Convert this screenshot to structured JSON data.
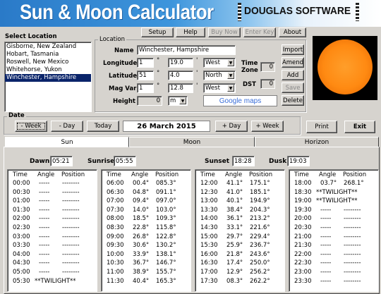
{
  "banner": {
    "title": "Sun & Moon Calculator",
    "company": "DOUGLAS SOFTWARE"
  },
  "menu": [
    {
      "label": "Setup",
      "enabled": true
    },
    {
      "label": "Help",
      "enabled": true
    },
    {
      "label": "Buy Now",
      "enabled": false
    },
    {
      "label": "Enter Key",
      "enabled": false
    },
    {
      "label": "About",
      "enabled": true
    }
  ],
  "select_location": {
    "title": "Select Location",
    "items": [
      "Gisborne, New Zealand",
      "Hobart, Tasmania",
      "Roswell, New Mexico",
      "Whitehorse, Yukon",
      "Winchester, Hampshire"
    ],
    "selected_index": 4
  },
  "location": {
    "title": "Location",
    "name_label": "Name",
    "name": "Winchester, Hampshire",
    "longitude_label": "Longitude",
    "lon_deg": "1",
    "lon_min": "19.0",
    "lon_dir": "West",
    "latitude_label": "Latitude",
    "lat_deg": "51",
    "lat_min": "4.0",
    "lat_dir": "North",
    "magvar_label": "Mag Var",
    "mag_deg": "1",
    "mag_min": "12.8",
    "mag_dir": "West",
    "height_label": "Height",
    "height": "0",
    "height_unit": "m",
    "deg_symbol": "°",
    "min_symbol": "'",
    "timezone_label": "Time Zone",
    "timezone": "0",
    "dst_label": "DST",
    "dst": "0",
    "maps_label": "Google maps"
  },
  "location_buttons": [
    {
      "label": "Import",
      "enabled": true
    },
    {
      "label": "Amend",
      "enabled": true
    },
    {
      "label": "Add",
      "enabled": true
    },
    {
      "label": "Save",
      "enabled": false
    },
    {
      "label": "Delete",
      "enabled": true
    }
  ],
  "date": {
    "title": "Date",
    "minus_week": "- Week",
    "minus_day": "- Day",
    "today": "Today",
    "current": "26 March 2015",
    "plus_day": "+ Day",
    "plus_week": "+ Week",
    "print": "Print",
    "exit": "Exit"
  },
  "tabs": [
    "Sun",
    "Moon",
    "Horizon"
  ],
  "active_tab": 0,
  "sun_events": {
    "dawn_label": "Dawn",
    "dawn": "05:21",
    "sunrise_label": "Sunrise",
    "sunrise": "05:55",
    "sunset_label": "Sunset",
    "sunset": "18:28",
    "dusk_label": "Dusk",
    "dusk": "19:03"
  },
  "table_headers": {
    "time": "Time",
    "angle": "Angle",
    "position": "Position"
  },
  "sun_tables": [
    [
      [
        "00:00",
        "-----",
        "--------"
      ],
      [
        "00:30",
        "-----",
        "--------"
      ],
      [
        "01:00",
        "-----",
        "--------"
      ],
      [
        "01:30",
        "-----",
        "--------"
      ],
      [
        "02:00",
        "-----",
        "--------"
      ],
      [
        "02:30",
        "-----",
        "--------"
      ],
      [
        "03:00",
        "-----",
        "--------"
      ],
      [
        "03:30",
        "-----",
        "--------"
      ],
      [
        "04:00",
        "-----",
        "--------"
      ],
      [
        "04:30",
        "-----",
        "--------"
      ],
      [
        "05:00",
        "-----",
        "--------"
      ],
      [
        "05:30",
        "**TWILIGHT**",
        ""
      ]
    ],
    [
      [
        "06:00",
        "00.4°",
        "085.3°"
      ],
      [
        "06:30",
        "04.8°",
        "091.1°"
      ],
      [
        "07:00",
        "09.4°",
        "097.0°"
      ],
      [
        "07:30",
        "14.0°",
        "103.0°"
      ],
      [
        "08:00",
        "18.5°",
        "109.3°"
      ],
      [
        "08:30",
        "22.8°",
        "115.8°"
      ],
      [
        "09:00",
        "26.8°",
        "122.8°"
      ],
      [
        "09:30",
        "30.6°",
        "130.2°"
      ],
      [
        "10:00",
        "33.9°",
        "138.1°"
      ],
      [
        "10:30",
        "36.7°",
        "146.7°"
      ],
      [
        "11:00",
        "38.9°",
        "155.7°"
      ],
      [
        "11:30",
        "40.4°",
        "165.3°"
      ]
    ],
    [
      [
        "12:00",
        "41.1°",
        "175.1°"
      ],
      [
        "12:30",
        "41.0°",
        "185.1°"
      ],
      [
        "13:00",
        "40.1°",
        "194.9°"
      ],
      [
        "13:30",
        "38.4°",
        "204.3°"
      ],
      [
        "14:00",
        "36.1°",
        "213.2°"
      ],
      [
        "14:30",
        "33.1°",
        "221.6°"
      ],
      [
        "15:00",
        "29.7°",
        "229.4°"
      ],
      [
        "15:30",
        "25.9°",
        "236.7°"
      ],
      [
        "16:00",
        "21.8°",
        "243.6°"
      ],
      [
        "16:30",
        "17.4°",
        "250.0°"
      ],
      [
        "17:00",
        "12.9°",
        "256.2°"
      ],
      [
        "17:30",
        "08.3°",
        "262.2°"
      ]
    ],
    [
      [
        "18:00",
        "03.7°",
        "268.1°"
      ],
      [
        "18:30",
        "**TWILIGHT**",
        ""
      ],
      [
        "19:00",
        "**TWILIGHT**",
        ""
      ],
      [
        "19:30",
        "-----",
        "--------"
      ],
      [
        "20:00",
        "-----",
        "--------"
      ],
      [
        "20:30",
        "-----",
        "--------"
      ],
      [
        "21:00",
        "-----",
        "--------"
      ],
      [
        "21:30",
        "-----",
        "--------"
      ],
      [
        "22:00",
        "-----",
        "--------"
      ],
      [
        "22:30",
        "-----",
        "--------"
      ],
      [
        "23:00",
        "-----",
        "--------"
      ],
      [
        "23:30",
        "-----",
        "--------"
      ]
    ]
  ]
}
